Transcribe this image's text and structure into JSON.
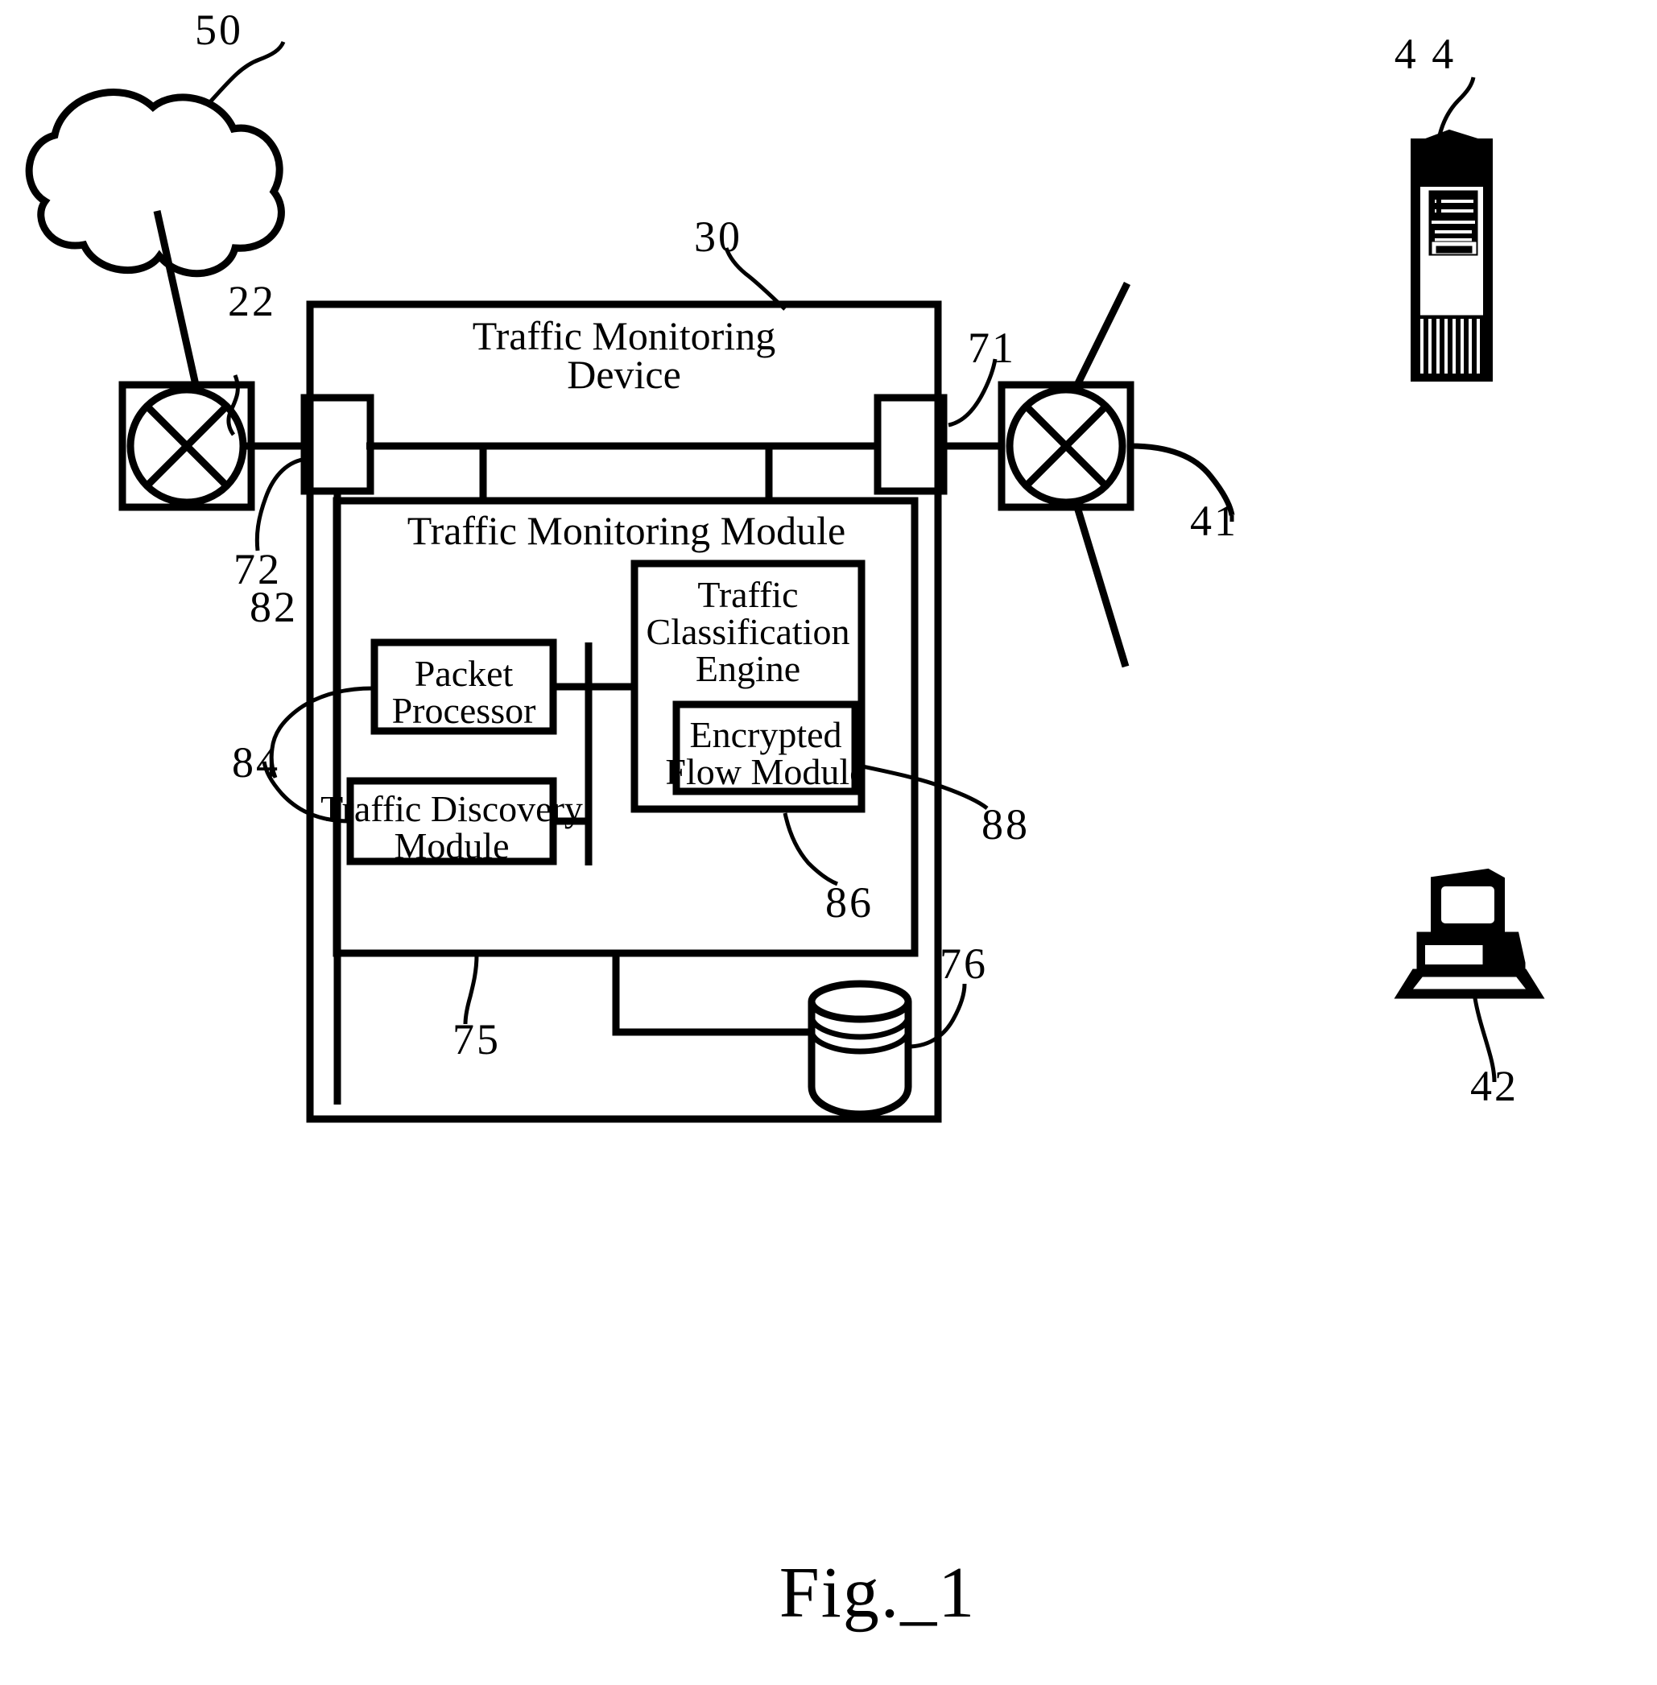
{
  "figure": {
    "caption": "Fig._1",
    "title_blocks": {
      "traffic_monitoring_device": "Traffic Monitoring\nDevice",
      "traffic_monitoring_device_line1": "Traffic Monitoring",
      "traffic_monitoring_device_line2": "Device",
      "traffic_monitoring_module": "Traffic Monitoring Module",
      "packet_processor_line1": "Packet",
      "packet_processor_line2": "Processor",
      "traffic_discovery_line1": "Traffic Discovery",
      "traffic_discovery_line2": "Module",
      "traffic_classification_line1": "Traffic",
      "traffic_classification_line2": "Classification",
      "traffic_classification_line3": "Engine",
      "encrypted_flow_line1": "Encrypted",
      "encrypted_flow_line2": "Flow Module"
    },
    "reference_numerals": {
      "cloud_network": "50",
      "left_switch": "22",
      "device_outer": "30",
      "right_port": "71",
      "left_port": "72",
      "packet_processor": "82",
      "traffic_discovery_module": "84",
      "traffic_classification_engine": "86",
      "encrypted_flow_module": "88",
      "module_bus": "75",
      "database": "76",
      "right_link": "41",
      "workstation": "42",
      "server": "4 4"
    },
    "icons": {
      "cloud": "network-cloud-icon",
      "left_switch": "network-switch-icon",
      "right_switch": "network-switch-icon",
      "server": "server-tower-icon",
      "workstation": "desktop-computer-icon",
      "database": "database-cylinder-icon"
    }
  }
}
